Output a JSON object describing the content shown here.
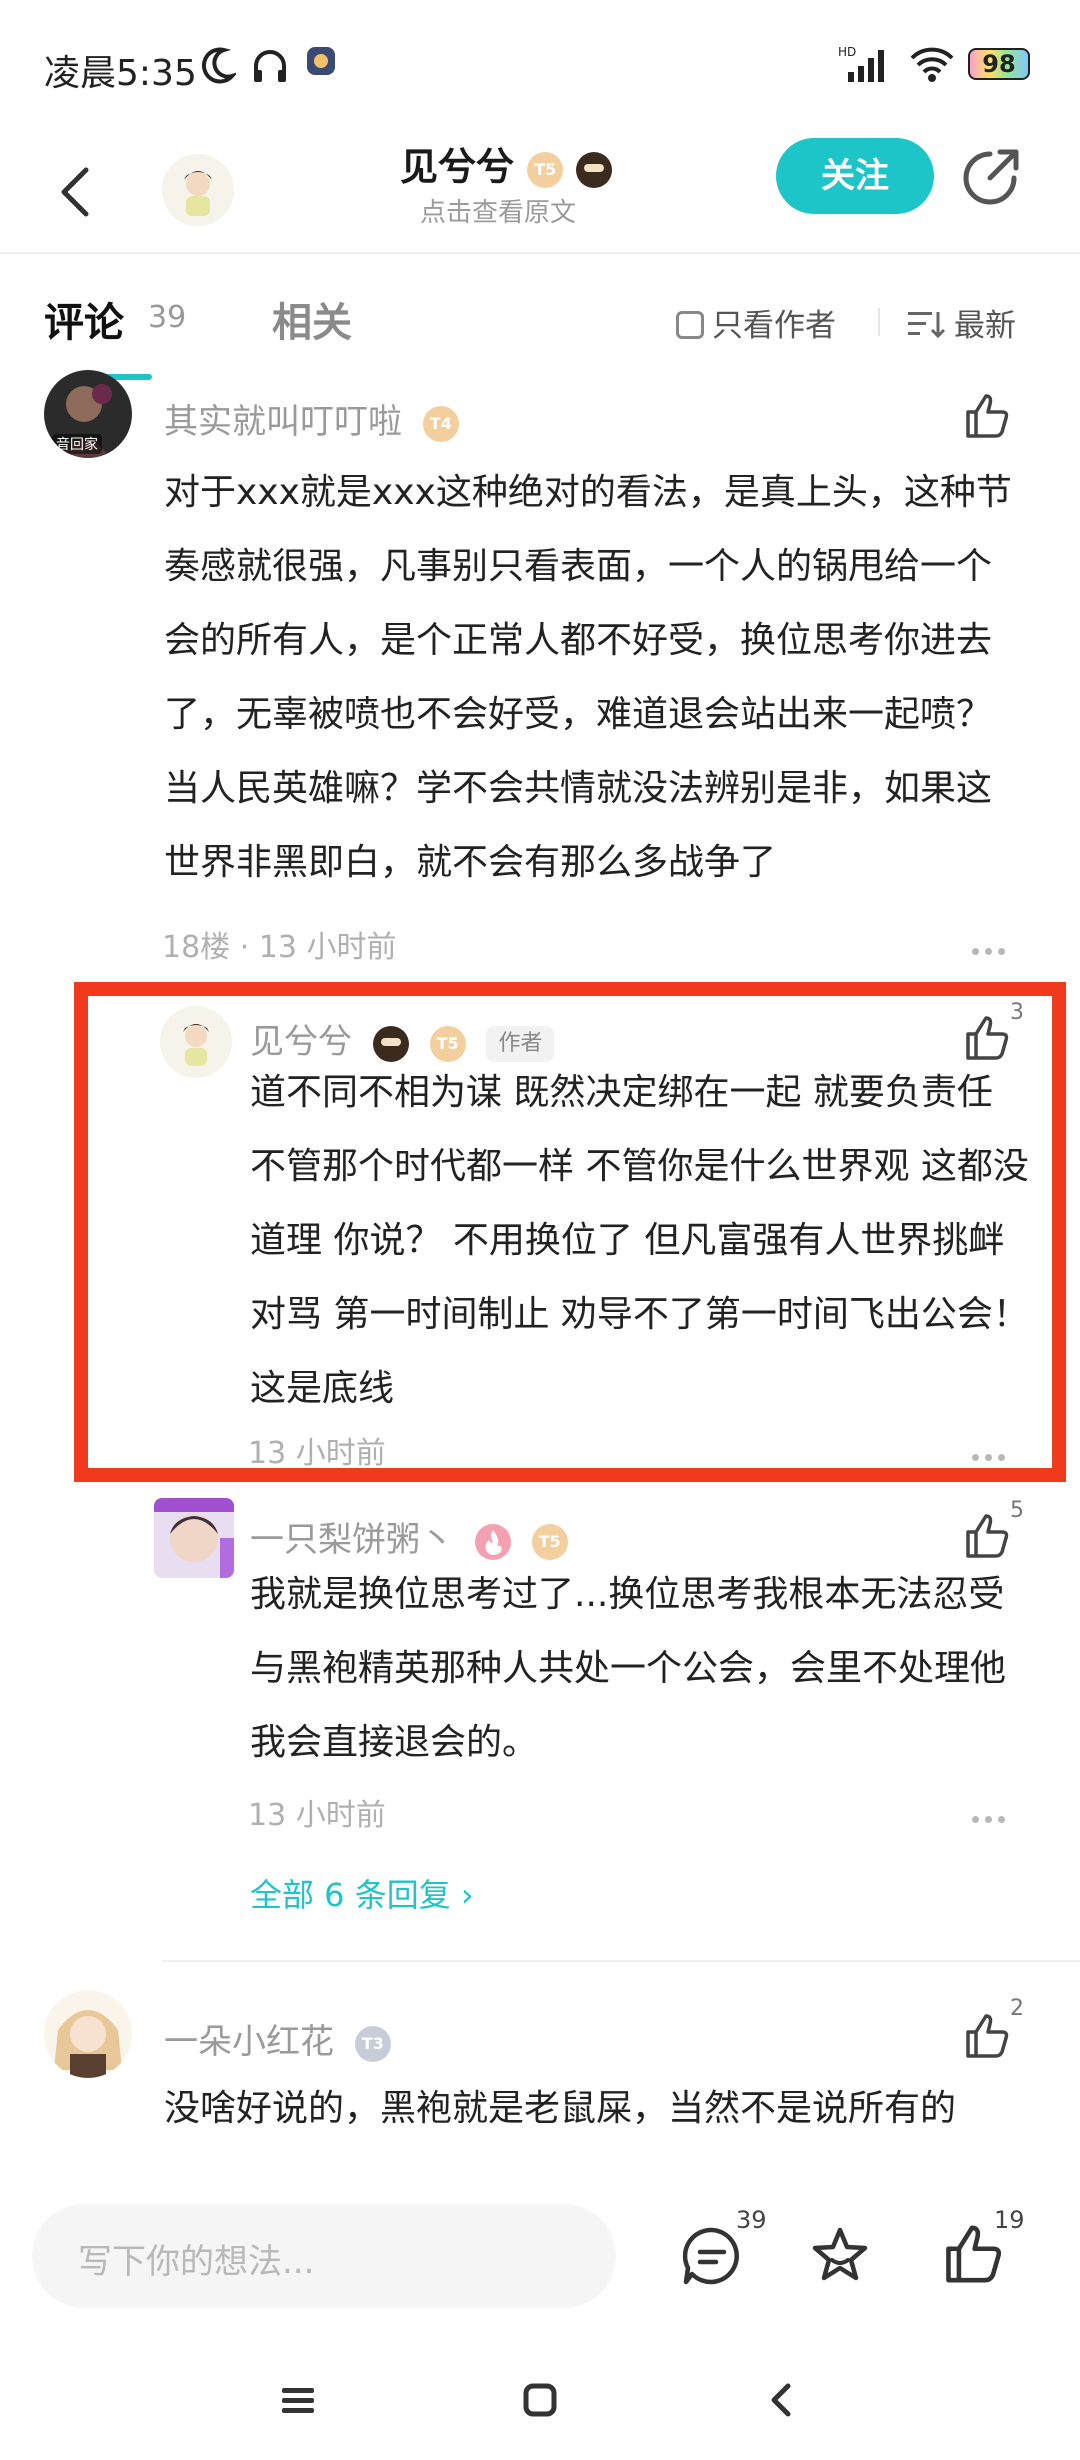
{
  "status": {
    "time": "凌晨5:35",
    "battery": "98"
  },
  "header": {
    "title": "见兮兮",
    "subtitle": "点击查看原文",
    "follow_label": "关注",
    "title_badge_level": "T5"
  },
  "tabs": {
    "comments_label": "评论",
    "comments_count": "39",
    "related_label": "相关",
    "only_author_label": "只看作者",
    "sort_label": "最新"
  },
  "comments": [
    {
      "name": "其实就叫叮叮啦",
      "badge": "T4",
      "text": "对于xxx就是xxx这种绝对的看法，是真上头，这种节奏感就很强，凡事别只看表面，一个人的锅甩给一个会的所有人，是个正常人都不好受，换位思考你进去了，无辜被喷也不会好受，难道退会站出来一起喷？当人民英雄嘛？学不会共情就没法辨别是非，如果这世界非黑即白，就不会有那么多战争了",
      "meta": "18楼 · 13 小时前",
      "avatar_caption": "音回家"
    },
    {
      "name": "见兮兮",
      "badge": "T5",
      "author_tag": "作者",
      "likes": "3",
      "text": "道不同不相为谋  既然决定绑在一起 就要负责任  不管那个时代都一样    不管你是什么世界观 这都没道理   你说？   不用换位了 但凡富强有人世界挑衅 对骂 第一时间制止 劝导不了第一时间飞出公会！这是底线",
      "meta": "13 小时前"
    },
    {
      "name": "一只梨饼粥丶",
      "badge": "T5",
      "likes": "5",
      "text": "我就是换位思考过了...换位思考我根本无法忍受与黑袍精英那种人共处一个公会，会里不处理他我会直接退会的。",
      "meta": "13 小时前"
    },
    {
      "all_replies": "全部 6 条回复 ›"
    },
    {
      "name": "一朵小红花",
      "badge": "T3",
      "likes": "2",
      "text": "没啥好说的，黑袍就是老鼠屎，当然不是说所有的"
    }
  ],
  "bottom": {
    "input_placeholder": "写下你的想法...",
    "comment_count": "39",
    "like_count": "19"
  },
  "colors": {
    "accent": "#1ec5c8",
    "highlight": "#f03a1e"
  }
}
